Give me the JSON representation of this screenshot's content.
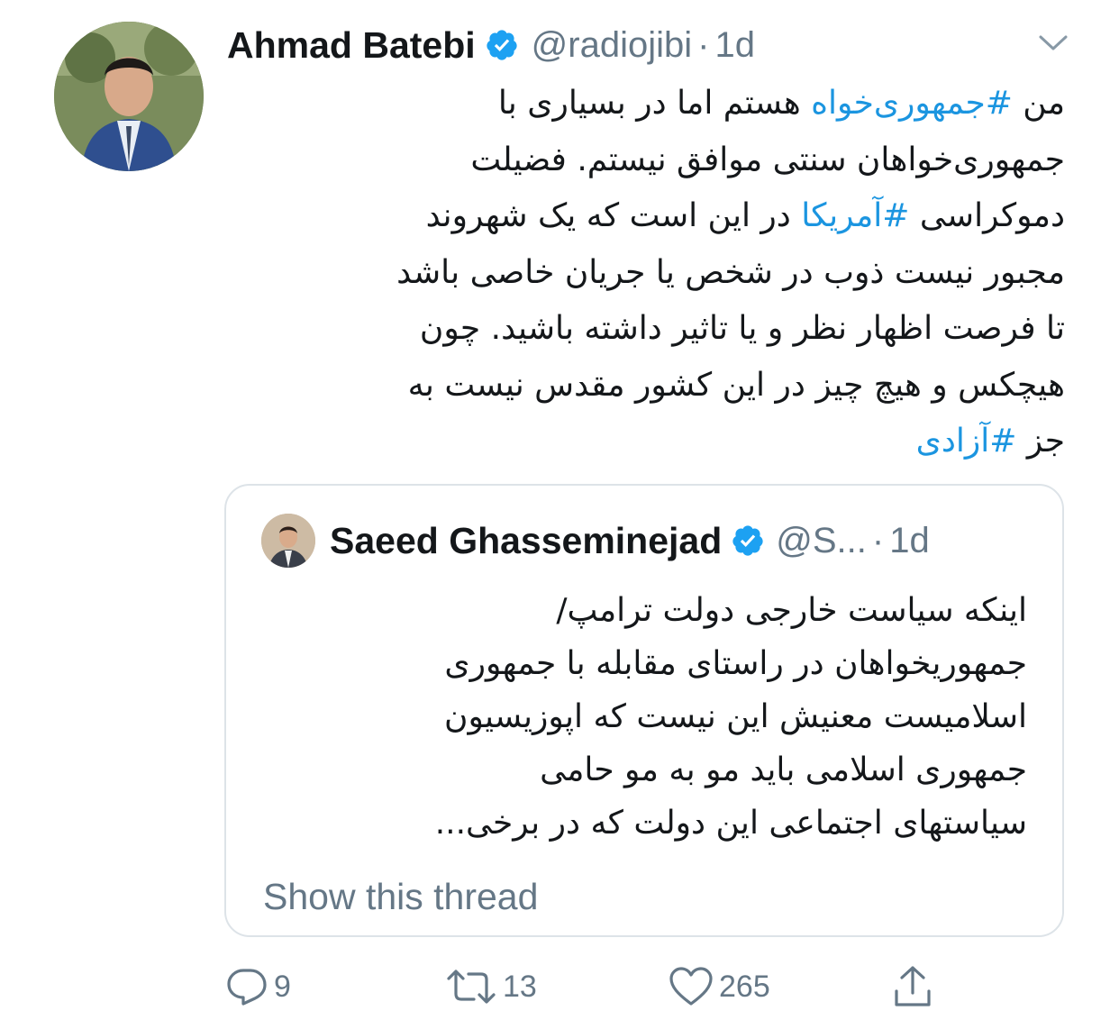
{
  "tweet": {
    "author_name": "Ahmad Batebi",
    "handle": "@radiojibi",
    "separator": "·",
    "time": "1d",
    "lines": [
      [
        {
          "t": "من "
        },
        {
          "t": "#جمهوری‌خواه",
          "tag": true
        },
        {
          "t": " هستم اما در بسیاری با"
        }
      ],
      [
        {
          "t": "جمهوری‌خواهان سنتی موافق نیستم. فضیلت"
        }
      ],
      [
        {
          "t": "دموکراسی "
        },
        {
          "t": "#آمریکا",
          "tag": true
        },
        {
          "t": " در این است که یک شهروند"
        }
      ],
      [
        {
          "t": "مجبور نیست ذوب در شخص یا جریان خاصی باشد"
        }
      ],
      [
        {
          "t": "تا فرصت اظهار نظر و یا تاثیر داشته باشید. چون"
        }
      ],
      [
        {
          "t": "هیچکس و هیچ چیز در این کشور مقدس نیست به"
        }
      ],
      [
        {
          "t": "جز "
        },
        {
          "t": "#آزادی",
          "tag": true
        }
      ]
    ]
  },
  "quote": {
    "author_name": "Saeed Ghasseminejad",
    "handle": "@S...",
    "separator": "·",
    "time": "1d",
    "lines": [
      "اینکه سیاست خارجی دولت ترامپ/",
      "جمهوریخواهان در راستای مقابله با جمهوری",
      "اسلامیست معنیش این نیست که اپوزیسیون",
      "جمهوری اسلامی باید مو به مو حامی",
      "سیاستهای اجتماعی این دولت که در برخی..."
    ],
    "show_thread": "Show this thread"
  },
  "actions": {
    "reply": {
      "icon": "reply-icon",
      "count": "9"
    },
    "retweet": {
      "icon": "retweet-icon",
      "count": "13"
    },
    "like": {
      "icon": "heart-icon",
      "count": "265"
    },
    "share": {
      "icon": "share-icon"
    }
  },
  "colors": {
    "link": "#1b95e0",
    "verified": "#1da1f2",
    "secondary": "#657786",
    "border": "#dde3e8"
  }
}
